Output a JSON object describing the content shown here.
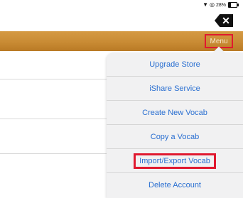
{
  "status_bar": {
    "battery_text": "28%"
  },
  "header": {
    "menu_label": "Menu"
  },
  "menu": {
    "items": [
      {
        "label": "Upgrade Store"
      },
      {
        "label": "iShare Service"
      },
      {
        "label": "Create New Vocab"
      },
      {
        "label": "Copy a Vocab"
      },
      {
        "label": "Import/Export Vocab"
      },
      {
        "label": "Delete Account"
      }
    ]
  },
  "colors": {
    "header": "#c98b34",
    "menu_text": "#2a6fd1",
    "highlight": "#e0192f"
  }
}
